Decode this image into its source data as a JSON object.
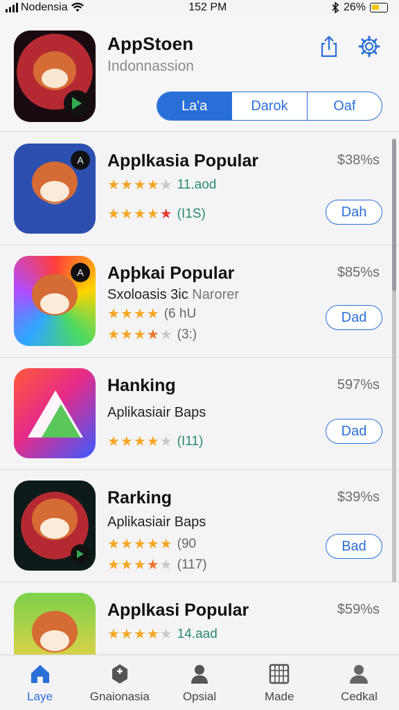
{
  "status_bar": {
    "carrier": "Nodensia",
    "time": "152 PM",
    "battery": "26%"
  },
  "header": {
    "title": "AppStoen",
    "subtitle": "Indonnassion",
    "segments": [
      "La'a",
      "Darok",
      "Oaf"
    ],
    "active_segment": 0
  },
  "apps": [
    {
      "title": "Applkasia Popular",
      "price": "$38%s",
      "subtitle": "",
      "ratings": [
        {
          "stars": 4,
          "count": "11.aod",
          "count_color": "teal"
        },
        {
          "stars": 5,
          "count": "(I1S)",
          "count_color": "teal"
        }
      ],
      "button": "Dah",
      "icon": "critter-icon"
    },
    {
      "title": "Apþkai Popular",
      "price": "$85%s",
      "subtitle": "Sxoloasis 3ic",
      "subtitle_extra": "Narorer",
      "ratings": [
        {
          "stars": 4,
          "count": "(6 hU",
          "count_color": "gray"
        },
        {
          "stars": 4,
          "count": "(3:)",
          "count_color": "gray"
        }
      ],
      "button": "Dad",
      "icon": "rainbow-critter-icon"
    },
    {
      "title": "Hanking",
      "price": "597%s",
      "subtitle": "Aplikasiair Baps",
      "ratings": [
        {
          "stars": 4,
          "count": "(I11)",
          "count_color": "teal"
        }
      ],
      "button": "Dad",
      "icon": "triangle-logo-icon"
    },
    {
      "title": "Rarking",
      "price": "$39%s",
      "subtitle": "Aplikasiair Baps",
      "ratings": [
        {
          "stars": 5,
          "count": "(90",
          "count_color": "gray"
        },
        {
          "stars": 4,
          "count": "(117)",
          "count_color": "gray"
        }
      ],
      "button": "Bad",
      "icon": "dark-critter-icon"
    },
    {
      "title": "Applkasi Popular",
      "price": "$59%s",
      "subtitle": "",
      "ratings": [
        {
          "stars": 4,
          "count": "14.aad",
          "count_color": "teal"
        }
      ],
      "button": "",
      "icon": "yellow-critter-icon"
    }
  ],
  "tabs": [
    {
      "label": "Laye",
      "icon": "home-icon",
      "active": true
    },
    {
      "label": "Gnaionasia",
      "icon": "games-icon",
      "active": false
    },
    {
      "label": "Opsial",
      "icon": "person-icon",
      "active": false
    },
    {
      "label": "Made",
      "icon": "calendar-icon",
      "active": false
    },
    {
      "label": "Cedkal",
      "icon": "account-icon",
      "active": false
    }
  ],
  "colors": {
    "accent": "#2a6fd8",
    "star": "#f5a623",
    "star_empty": "#c8c8cc",
    "count_teal": "#2a8a6e"
  }
}
